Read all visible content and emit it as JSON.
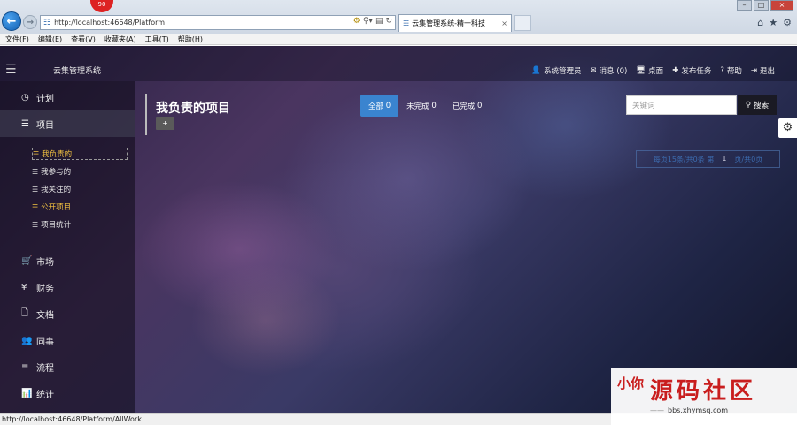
{
  "browser": {
    "url": "http://localhost:46648/Platform",
    "tab_title": "云集管理系统-精一科技",
    "badge": "90",
    "menu": [
      "文件(F)",
      "编辑(E)",
      "查看(V)",
      "收藏夹(A)",
      "工具(T)",
      "帮助(H)"
    ],
    "status_url": "http://localhost:46648/Platform/AllWork"
  },
  "app": {
    "title": "云集管理系统",
    "top_nav": [
      {
        "icon": "user-icon",
        "glyph": "👤",
        "label": "系统管理员"
      },
      {
        "icon": "envelope-icon",
        "glyph": "✉",
        "label": "消息 (0)"
      },
      {
        "icon": "desktop-icon",
        "glyph": "🖥",
        "label": "桌面"
      },
      {
        "icon": "plus-icon",
        "glyph": "✚",
        "label": "发布任务"
      },
      {
        "icon": "question-icon",
        "glyph": "?",
        "label": "帮助"
      },
      {
        "icon": "logout-icon",
        "glyph": "⇥",
        "label": "退出"
      }
    ],
    "sidebar": {
      "items": [
        {
          "icon": "clock-icon",
          "glyph": "◷",
          "label": "计划"
        },
        {
          "icon": "list-icon",
          "glyph": "☰",
          "label": "项目"
        },
        {
          "icon": "cart-icon",
          "glyph": "🛒",
          "label": "市场"
        },
        {
          "icon": "yen-icon",
          "glyph": "¥",
          "label": "财务"
        },
        {
          "icon": "document-icon",
          "glyph": "🗋",
          "label": "文档"
        },
        {
          "icon": "users-icon",
          "glyph": "👥",
          "label": "同事"
        },
        {
          "icon": "flow-icon",
          "glyph": "≡",
          "label": "流程"
        },
        {
          "icon": "bar-chart-icon",
          "glyph": "📊",
          "label": "统计"
        }
      ],
      "sub_items": [
        {
          "label": "我负责的"
        },
        {
          "label": "我参与的"
        },
        {
          "label": "我关注的"
        },
        {
          "label": "公开项目"
        },
        {
          "label": "项目统计"
        }
      ]
    },
    "main": {
      "title": "我负责的项目",
      "add_label": "+",
      "filters": [
        {
          "label": "全部",
          "count": "0"
        },
        {
          "label": "未完成",
          "count": "0"
        },
        {
          "label": "已完成",
          "count": "0"
        }
      ],
      "search_placeholder": "关键词",
      "search_label": "搜索",
      "pager": {
        "prefix": "每页15条/共0条 第",
        "page": "1",
        "suffix": "页/共0页"
      }
    }
  },
  "watermark": {
    "title": "源码社区",
    "seal": "小你",
    "site": "bbs.xhymsq.com"
  }
}
